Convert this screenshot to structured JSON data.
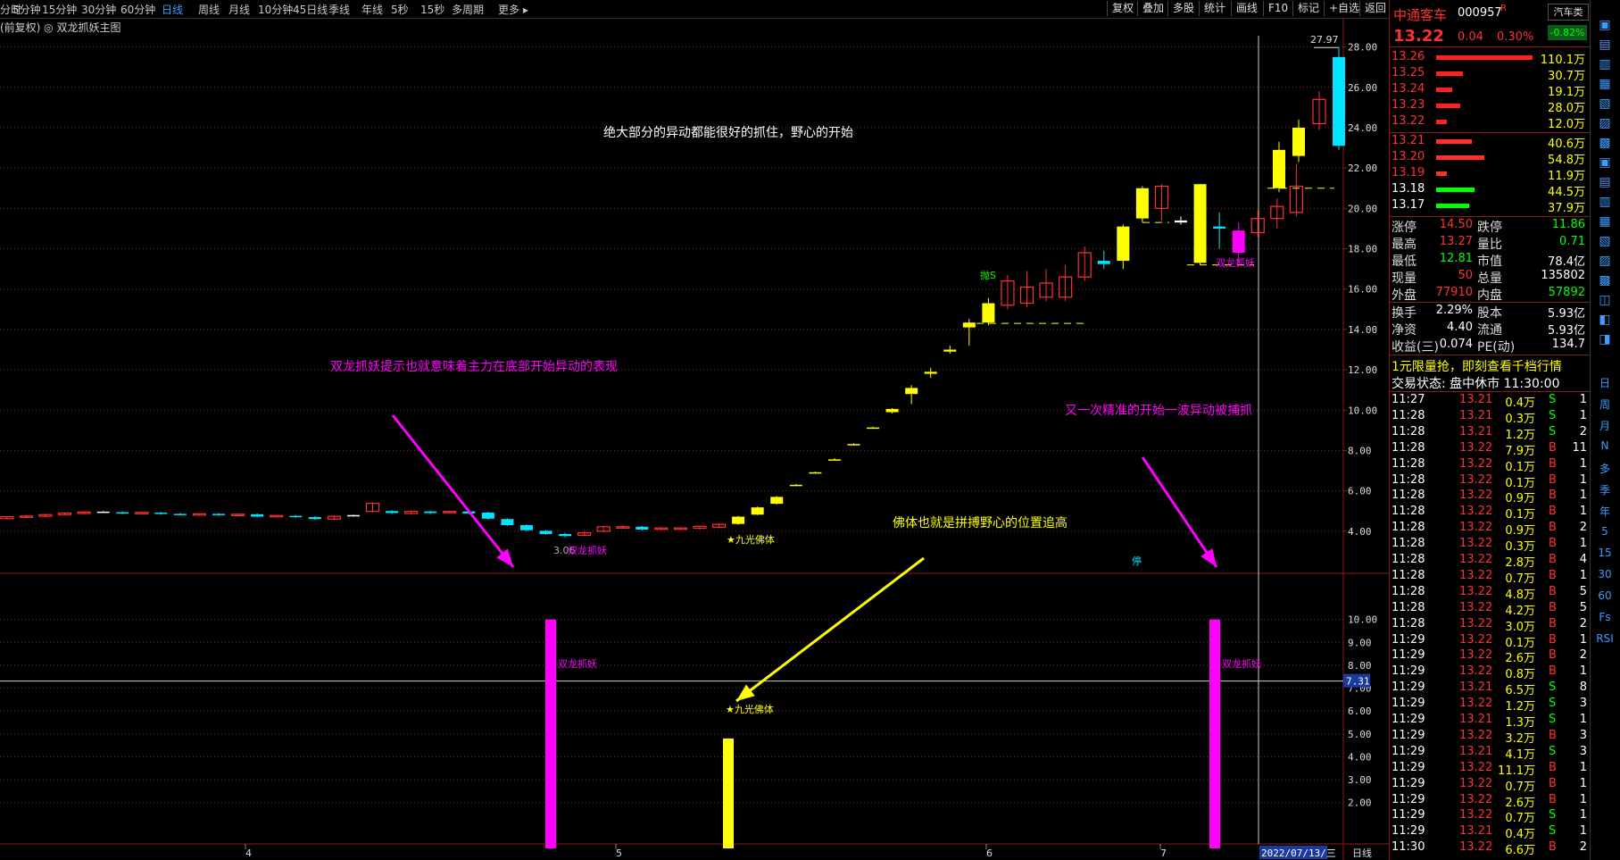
{
  "colors": {
    "up": "#ff3030",
    "down": "#00ff00",
    "cyan": "#00e5ff",
    "yellow": "#ffff00",
    "magenta": "#ff00ff",
    "blue": "#3d9cff",
    "gridRed": "#8a1a1a"
  },
  "toolbar": {
    "periods": [
      "分时",
      "5分钟",
      "15分钟",
      "30分钟",
      "60分钟",
      "日线",
      "周线",
      "月线",
      "10分钟",
      "45日线",
      "季线",
      "年线",
      "5秒",
      "15秒",
      "多周期",
      "更多 ▸"
    ],
    "active_period": "日线",
    "right_buttons": [
      "复权",
      "叠加",
      "多股",
      "统计",
      "画线",
      "F10",
      "标记",
      "+自选",
      "返回"
    ]
  },
  "indicator_line": "(前复权) ◎ 双龙抓妖主图",
  "main_axis": {
    "ticks": [
      "28.00",
      "26.00",
      "24.00",
      "22.00",
      "20.00",
      "18.00",
      "16.00",
      "14.00",
      "12.00",
      "10.00",
      "8.00",
      "6.00",
      "4.00"
    ]
  },
  "sub_axis": {
    "ticks": [
      "10.00",
      "9.00",
      "8.00",
      "7.00",
      "6.00",
      "5.00",
      "4.00",
      "3.00",
      "2.00"
    ],
    "crosshair_value": "7.31"
  },
  "date_axis": {
    "labels": [
      "4",
      "5",
      "6",
      "7"
    ],
    "cursor_date": "2022/07/13/三",
    "period_label": "日线"
  },
  "annotations": {
    "top_text": "绝大部分的异动都能很好的抓住，野心的开始",
    "left_text": "双龙抓妖提示也就意味着主力在底部开始异动的表现",
    "right_text": "又一次精准的开始一波异动被捕抓",
    "middle_text": "佛体也就是拼搏野心的位置追高",
    "high_label": "27.97",
    "low_label": "3.06",
    "sell_label": "抛S",
    "stop_label": "停",
    "candle_tag_1": "双龙抓妖",
    "candle_tag_2": "★九光佛体",
    "candle_tag_3": "双龙抓妖",
    "sub_tag_1": "双龙抓妖",
    "sub_tag_2": "★九光佛体",
    "sub_tag_3": "双龙抓妖"
  },
  "chart_data": {
    "type": "candlestick",
    "y_range": [
      2.0,
      29.0
    ],
    "sub_y_range": [
      0,
      11
    ],
    "sub_bars": [
      {
        "label": "双龙抓妖",
        "value": 10.0
      },
      {
        "label": "九光佛体",
        "value": 4.8
      },
      {
        "label": "双龙抓妖",
        "value": 10.0
      }
    ]
  },
  "quote": {
    "name": "中通客车",
    "code": "000957",
    "r_flag": "R",
    "category": "汽车类",
    "category_change": "-0.82%",
    "price": "13.22",
    "change": "0.04",
    "change_pct": "0.30%",
    "asks": [
      {
        "price": "13.26",
        "vol": "110.1万",
        "bar": 1.0
      },
      {
        "price": "13.25",
        "vol": "30.7万",
        "bar": 0.28
      },
      {
        "price": "13.24",
        "vol": "19.1万",
        "bar": 0.17
      },
      {
        "price": "13.23",
        "vol": "28.0万",
        "bar": 0.25
      },
      {
        "price": "13.22",
        "vol": "12.0万",
        "bar": 0.11
      }
    ],
    "bids": [
      {
        "price": "13.21",
        "vol": "40.6万",
        "bar": 0.37,
        "color": "red"
      },
      {
        "price": "13.20",
        "vol": "54.8万",
        "bar": 0.5,
        "color": "red"
      },
      {
        "price": "13.19",
        "vol": "11.9万",
        "bar": 0.11,
        "color": "red"
      },
      {
        "price": "13.18",
        "vol": "44.5万",
        "bar": 0.4,
        "color": "green"
      },
      {
        "price": "13.17",
        "vol": "37.9万",
        "bar": 0.34,
        "color": "green"
      }
    ],
    "stats": [
      {
        "l1": "涨停",
        "v1": "14.50",
        "c1": "red",
        "l2": "跌停",
        "v2": "11.86",
        "c2": "green"
      },
      {
        "l1": "最高",
        "v1": "13.27",
        "c1": "red",
        "l2": "量比",
        "v2": "0.71",
        "c2": "green"
      },
      {
        "l1": "最低",
        "v1": "12.81",
        "c1": "green",
        "l2": "市值",
        "v2": "78.4亿",
        "c2": "white"
      },
      {
        "l1": "现量",
        "v1": "50",
        "c1": "red",
        "l2": "总量",
        "v2": "135802",
        "c2": "white"
      },
      {
        "l1": "外盘",
        "v1": "77910",
        "c1": "red",
        "l2": "内盘",
        "v2": "57892",
        "c2": "green"
      }
    ],
    "stats2": [
      {
        "l1": "换手",
        "v1": "2.29%",
        "l2": "股本",
        "v2": "5.93亿"
      },
      {
        "l1": "净资",
        "v1": "4.40",
        "l2": "流通",
        "v2": "5.93亿"
      },
      {
        "l1": "收益(三)",
        "v1": "0.074",
        "l2": "PE(动)",
        "v2": "134.7"
      }
    ],
    "promo": "1元限量抢，即刻查看千档行情",
    "trade_status": "交易状态: 盘中休市 11:30:00",
    "ticks": [
      [
        "11:27",
        "13.21",
        "0.4万",
        "S",
        "1"
      ],
      [
        "11:28",
        "13.21",
        "0.3万",
        "S",
        "1"
      ],
      [
        "11:28",
        "13.21",
        "1.2万",
        "S",
        "2"
      ],
      [
        "11:28",
        "13.22",
        "7.9万",
        "B",
        "11"
      ],
      [
        "11:28",
        "13.22",
        "0.1万",
        "B",
        "1"
      ],
      [
        "11:28",
        "13.22",
        "0.1万",
        "B",
        "1"
      ],
      [
        "11:28",
        "13.22",
        "0.9万",
        "B",
        "1"
      ],
      [
        "11:28",
        "13.22",
        "0.1万",
        "B",
        "1"
      ],
      [
        "11:28",
        "13.22",
        "0.9万",
        "B",
        "2"
      ],
      [
        "11:28",
        "13.22",
        "0.3万",
        "B",
        "1"
      ],
      [
        "11:28",
        "13.22",
        "2.8万",
        "B",
        "4"
      ],
      [
        "11:28",
        "13.22",
        "0.7万",
        "B",
        "1"
      ],
      [
        "11:28",
        "13.22",
        "4.8万",
        "B",
        "5"
      ],
      [
        "11:28",
        "13.22",
        "4.2万",
        "B",
        "5"
      ],
      [
        "11:28",
        "13.22",
        "3.0万",
        "B",
        "2"
      ],
      [
        "11:29",
        "13.22",
        "0.1万",
        "B",
        "1"
      ],
      [
        "11:29",
        "13.22",
        "2.6万",
        "B",
        "2"
      ],
      [
        "11:29",
        "13.22",
        "0.8万",
        "B",
        "1"
      ],
      [
        "11:29",
        "13.21",
        "6.5万",
        "S",
        "8"
      ],
      [
        "11:29",
        "13.22",
        "1.2万",
        "S",
        "3"
      ],
      [
        "11:29",
        "13.21",
        "1.3万",
        "S",
        "1"
      ],
      [
        "11:29",
        "13.22",
        "3.2万",
        "B",
        "3"
      ],
      [
        "11:29",
        "13.21",
        "4.1万",
        "S",
        "3"
      ],
      [
        "11:29",
        "13.22",
        "11.1万",
        "B",
        "1"
      ],
      [
        "11:29",
        "13.22",
        "0.7万",
        "B",
        "1"
      ],
      [
        "11:29",
        "13.22",
        "2.6万",
        "B",
        "1"
      ],
      [
        "11:29",
        "13.22",
        "0.7万",
        "S",
        "1"
      ],
      [
        "11:29",
        "13.21",
        "0.4万",
        "S",
        "1"
      ],
      [
        "11:30",
        "13.22",
        "6.6万",
        "B",
        "2"
      ]
    ]
  },
  "sidebar": [
    "日",
    "周",
    "月",
    "N",
    "多",
    "季",
    "年",
    "5",
    "15",
    "30",
    "60",
    "Fs",
    "RSI"
  ]
}
